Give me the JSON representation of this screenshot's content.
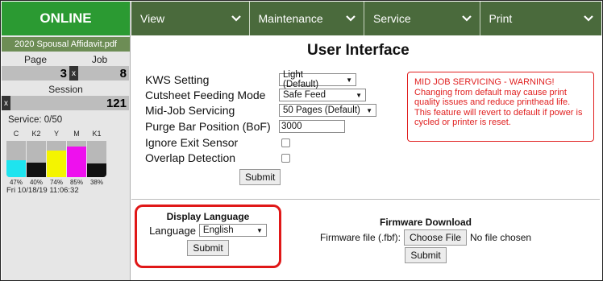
{
  "sidebar": {
    "status": "ONLINE",
    "document": "2020 Spousal Affidavit.pdf",
    "page_label": "Page",
    "job_label": "Job",
    "page_value": "3",
    "job_value": "8",
    "clear_symbol": "x",
    "session_label": "Session",
    "session_value": "121",
    "service_text": "Service:  0/50",
    "inks": [
      {
        "name": "C",
        "percent": "47%",
        "level": 0.47,
        "color": "#1ee4ef"
      },
      {
        "name": "K2",
        "percent": "40%",
        "level": 0.4,
        "color": "#111111"
      },
      {
        "name": "Y",
        "percent": "74%",
        "level": 0.74,
        "color": "#f4f400"
      },
      {
        "name": "M",
        "percent": "85%",
        "level": 0.85,
        "color": "#ee10ee"
      },
      {
        "name": "K1",
        "percent": "38%",
        "level": 0.38,
        "color": "#111111"
      }
    ],
    "timestamp": "Fri 10/18/19 11:06:32"
  },
  "nav": [
    {
      "label": "View",
      "icon": "chevron-down-icon"
    },
    {
      "label": "Maintenance",
      "icon": "chevron-down-icon"
    },
    {
      "label": "Service",
      "icon": "chevron-down-icon"
    },
    {
      "label": "Print",
      "icon": "chevron-down-icon"
    }
  ],
  "main": {
    "title": "User Interface",
    "settings": {
      "kws_label": "KWS Setting",
      "kws_value": "Light (Default)",
      "cutsheet_label": "Cutsheet Feeding Mode",
      "cutsheet_value": "Safe Feed",
      "midjob_label": "Mid-Job Servicing",
      "midjob_value": "50 Pages (Default)",
      "purge_label": "Purge Bar Position (BoF)",
      "purge_value": "3000",
      "ignore_exit_label": "Ignore Exit Sensor",
      "overlap_label": "Overlap Detection",
      "submit_label": "Submit"
    },
    "warning": {
      "title": "MID JOB SERVICING - WARNING!",
      "body": "Changing from default may cause print quality issues and reduce printhead life. This feature will revert to default if power is cycled or printer is reset."
    },
    "language": {
      "title": "Display Language",
      "label": "Language",
      "value": "English",
      "submit_label": "Submit"
    },
    "firmware": {
      "title": "Firmware Download",
      "file_label": "Firmware file (.fbf):",
      "choose_label": "Choose File",
      "no_file": "No file chosen",
      "submit_label": "Submit"
    }
  },
  "colors": {
    "online_green": "#2b9a32",
    "nav_green": "#4a6a3c",
    "doc_green": "#6d8d55",
    "warning_red": "#e02020"
  }
}
